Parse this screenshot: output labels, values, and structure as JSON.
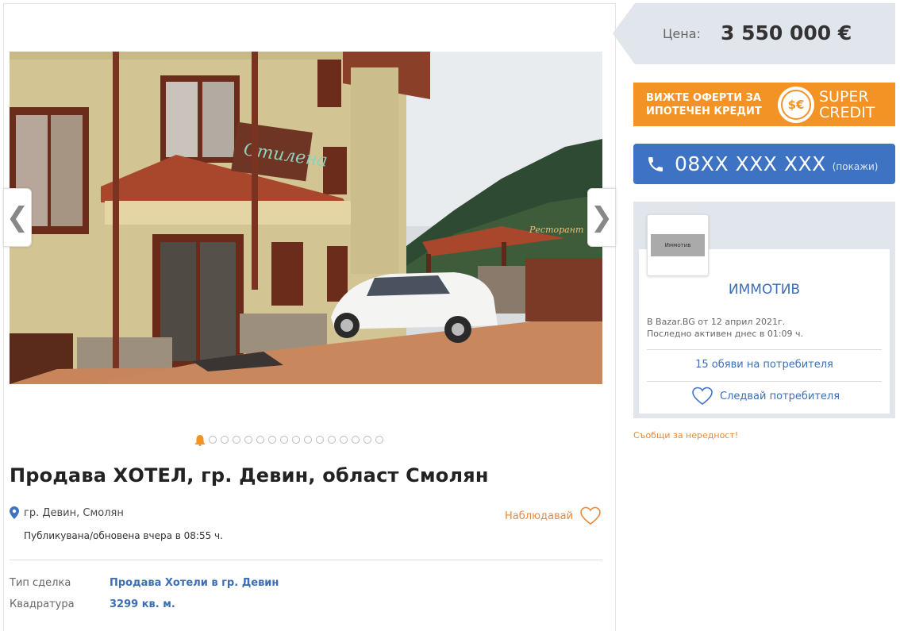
{
  "gallery": {
    "prev_arrow": "❮",
    "next_arrow": "❯",
    "dot_count": 16,
    "active_index": 0,
    "photo_sign_text": "Стилена",
    "photo_restaurant_sign": "Ресторант"
  },
  "listing": {
    "title": "Продава ХОТЕЛ, гр. Девин, област Смолян",
    "location": "гр. Девин, Смолян",
    "published": "Публикувана/обновена вчера в 08:55 ч.",
    "watch_label": "Наблюдавай",
    "details": [
      {
        "label": "Тип сделка",
        "value": "Продава Хотели в гр. Девин"
      },
      {
        "label": "Квадратура",
        "value": "3299 кв. м."
      }
    ]
  },
  "price": {
    "label": "Цена:",
    "value": "3 550 000 €"
  },
  "credit_banner": {
    "line1": "ВИЖТЕ ОФЕРТИ ЗА",
    "line2": "ИПОТЕЧЕН КРЕДИТ",
    "coin": "$€",
    "brand_line1": "SUPER",
    "brand_line2": "CREDIT"
  },
  "phone": {
    "number": "08XX XXX XXX",
    "show_label": "(покажи)"
  },
  "seller": {
    "logo_text": "Иммотив",
    "name": "ИММОТИВ",
    "member_since": "В Bazar.BG от 12 април 2021г.",
    "last_active": "Последно активен днес в 01:09 ч.",
    "ads_link": "15 обяви на потребителя",
    "follow_label": "Следвай потребителя"
  },
  "report_link": "Съобщи за нередност!",
  "colors": {
    "accent_blue": "#3d73c2",
    "orange": "#f39325",
    "watch_orange": "#e8893a",
    "panel_gray": "#e1e6ec"
  },
  "icons": {
    "phone": "phone-icon",
    "heart": "heart-icon",
    "pin": "location-pin-icon"
  }
}
